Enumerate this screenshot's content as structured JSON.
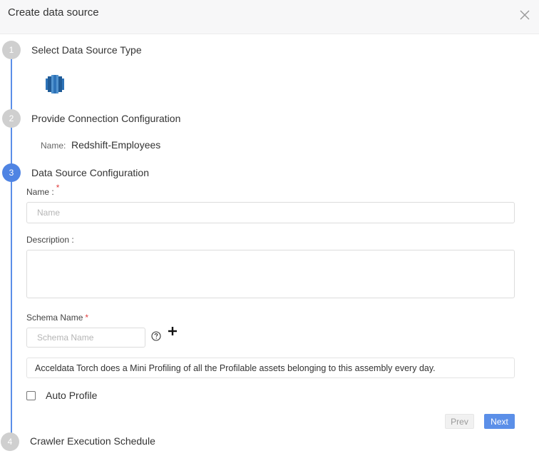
{
  "dialog": {
    "title": "Create data source"
  },
  "steps": [
    {
      "number": "1",
      "title": "Select Data Source Type",
      "state": "completed"
    },
    {
      "number": "2",
      "title": "Provide Connection Configuration",
      "state": "completed"
    },
    {
      "number": "3",
      "title": "Data Source Configuration",
      "state": "active"
    },
    {
      "number": "4",
      "title": "Crawler Execution Schedule",
      "state": "pending"
    }
  ],
  "step1": {
    "selected_icon": "redshift-database-icon"
  },
  "step2": {
    "name_label": "Name:",
    "name_value": "Redshift-Employees"
  },
  "form": {
    "name_label": "Name :",
    "name_required": "*",
    "name_placeholder": "Name",
    "name_value": "",
    "description_label": "Description :",
    "description_value": "",
    "schema_label": "Schema Name",
    "schema_required": "*",
    "schema_placeholder": "Schema Name",
    "schema_value": "",
    "info_text": "Acceldata Torch does a Mini Profiling of all the Profilable assets belonging to this assembly every day.",
    "auto_profile_label": "Auto Profile",
    "auto_profile_checked": false
  },
  "nav": {
    "prev_label": "Prev",
    "next_label": "Next"
  },
  "colors": {
    "accent": "#4f84e3",
    "timeline": "#5b8fe8",
    "inactive_step": "#cfcfcf",
    "required": "#e03c3c",
    "header_bg": "#f7f7f8"
  }
}
